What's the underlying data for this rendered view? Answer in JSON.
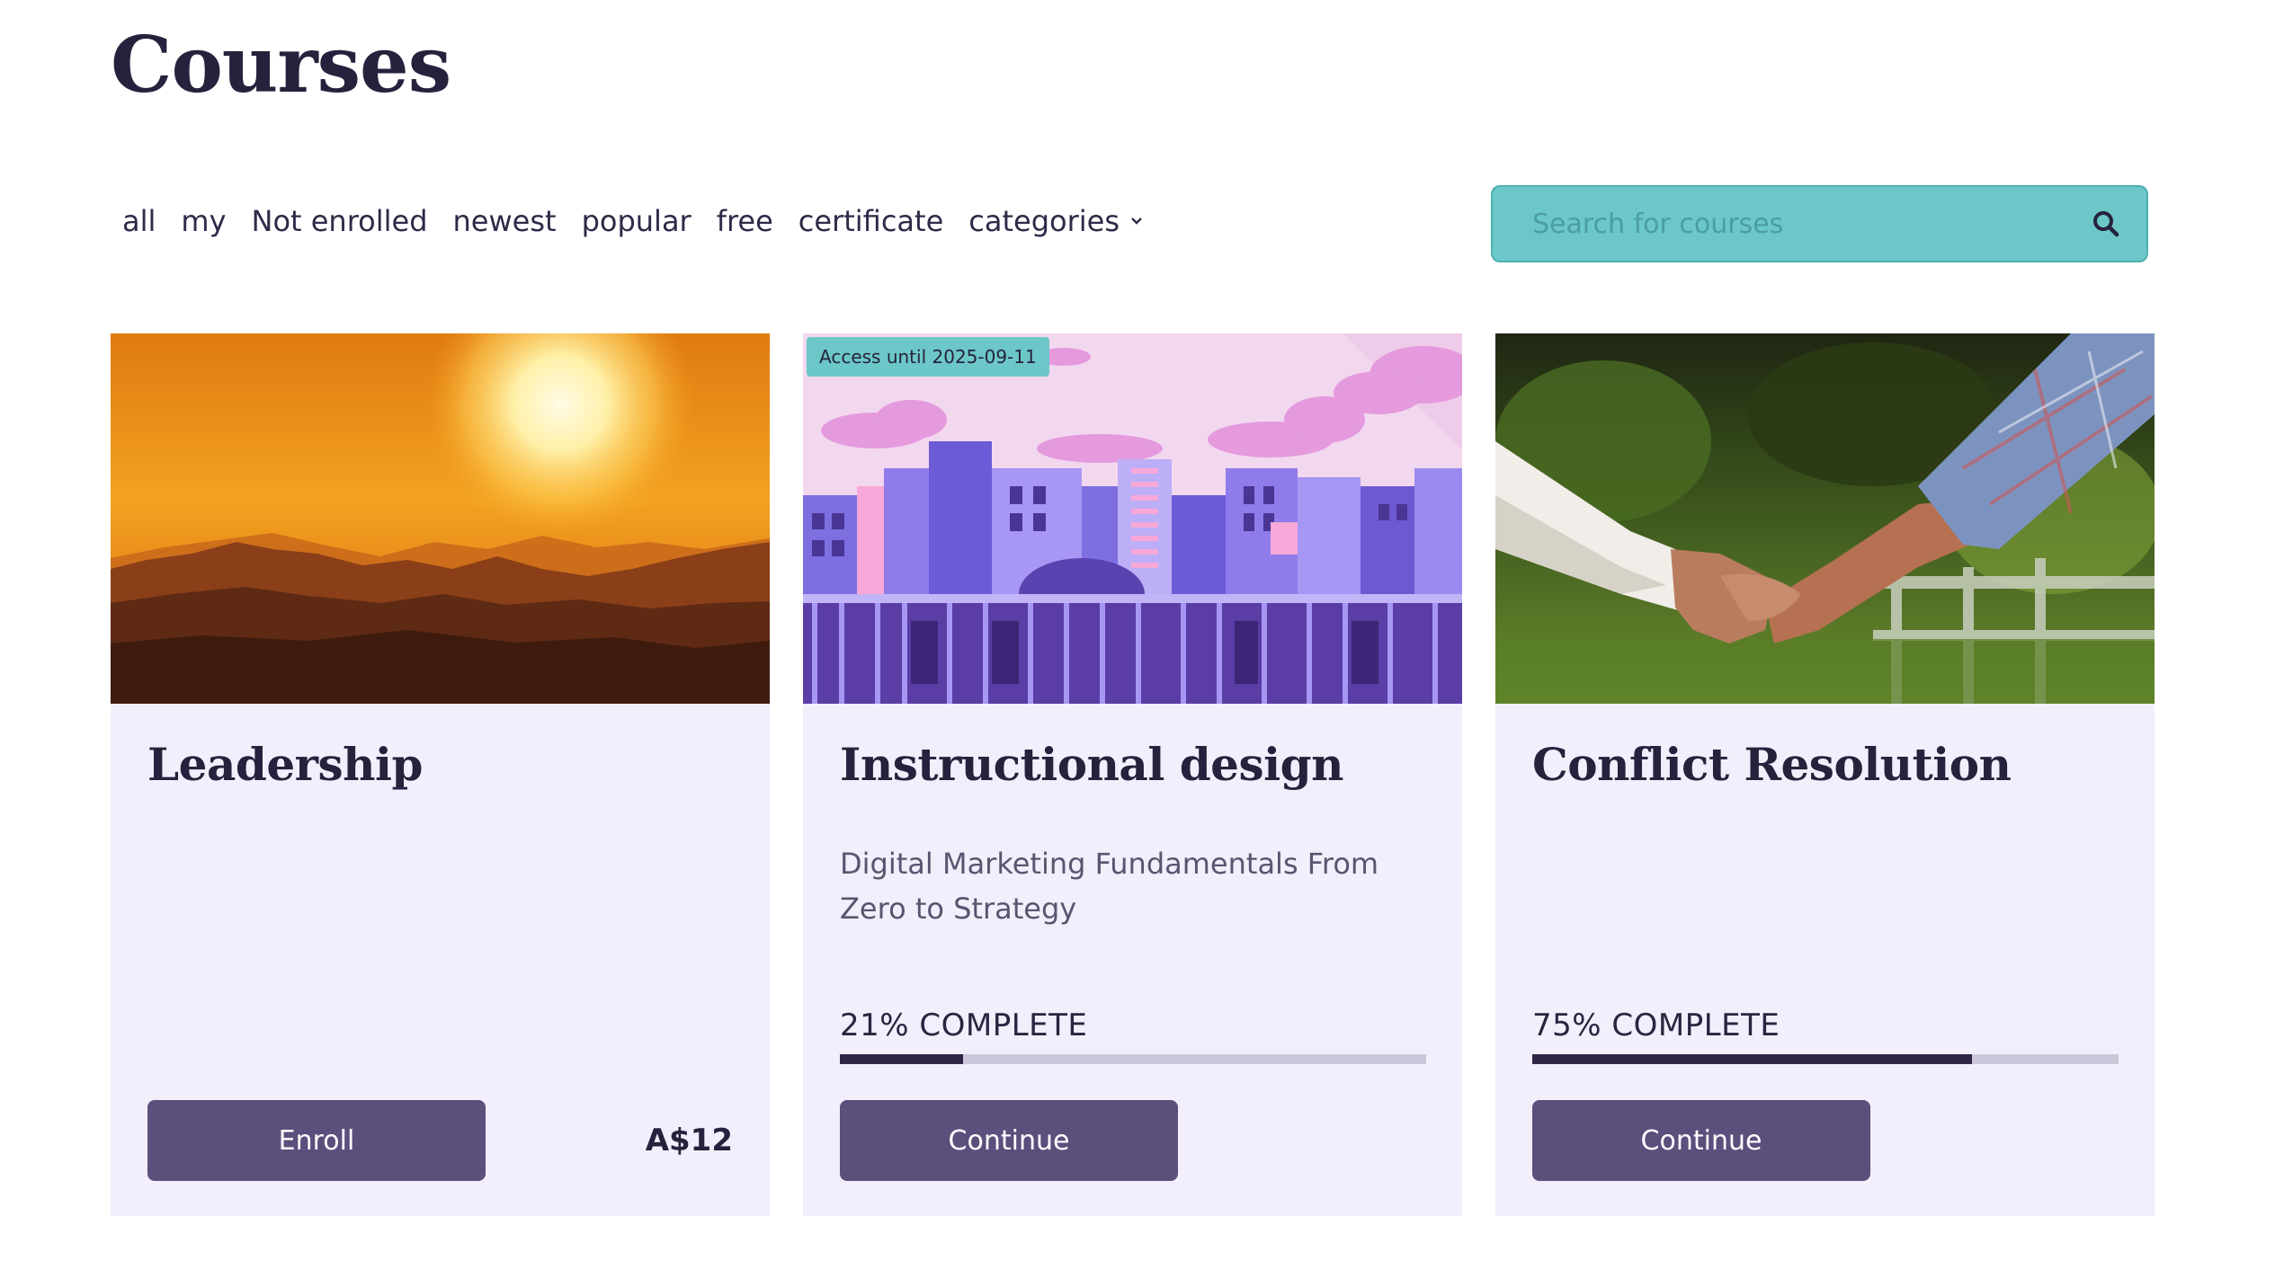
{
  "page": {
    "title": "Courses"
  },
  "filters": [
    {
      "label": "all"
    },
    {
      "label": "my"
    },
    {
      "label": "Not enrolled"
    },
    {
      "label": "newest"
    },
    {
      "label": "popular"
    },
    {
      "label": "free"
    },
    {
      "label": "certificate"
    },
    {
      "label": "categories",
      "dropdown": true
    }
  ],
  "search": {
    "placeholder": "Search for courses",
    "icon": "search-icon"
  },
  "colors": {
    "accent": "#6cc7c8",
    "button": "#5b4f7c",
    "card_bg": "#f2eefb",
    "progress_fill": "#2e2546"
  },
  "courses": [
    {
      "title": "Leadership",
      "image": "sunset-mountains",
      "button": "Enroll",
      "price": "A$12"
    },
    {
      "title": "Instructional design",
      "image": "purple-city-illustration",
      "badge": "Access until 2025-09-11",
      "description": "Digital Marketing Fundamentals From Zero to Strategy",
      "progress_label": "21% COMPLETE",
      "progress": 0.21,
      "button": "Continue"
    },
    {
      "title": "Conflict Resolution",
      "image": "handshake-photo",
      "progress_label": "75% COMPLETE",
      "progress": 0.75,
      "button": "Continue"
    }
  ]
}
